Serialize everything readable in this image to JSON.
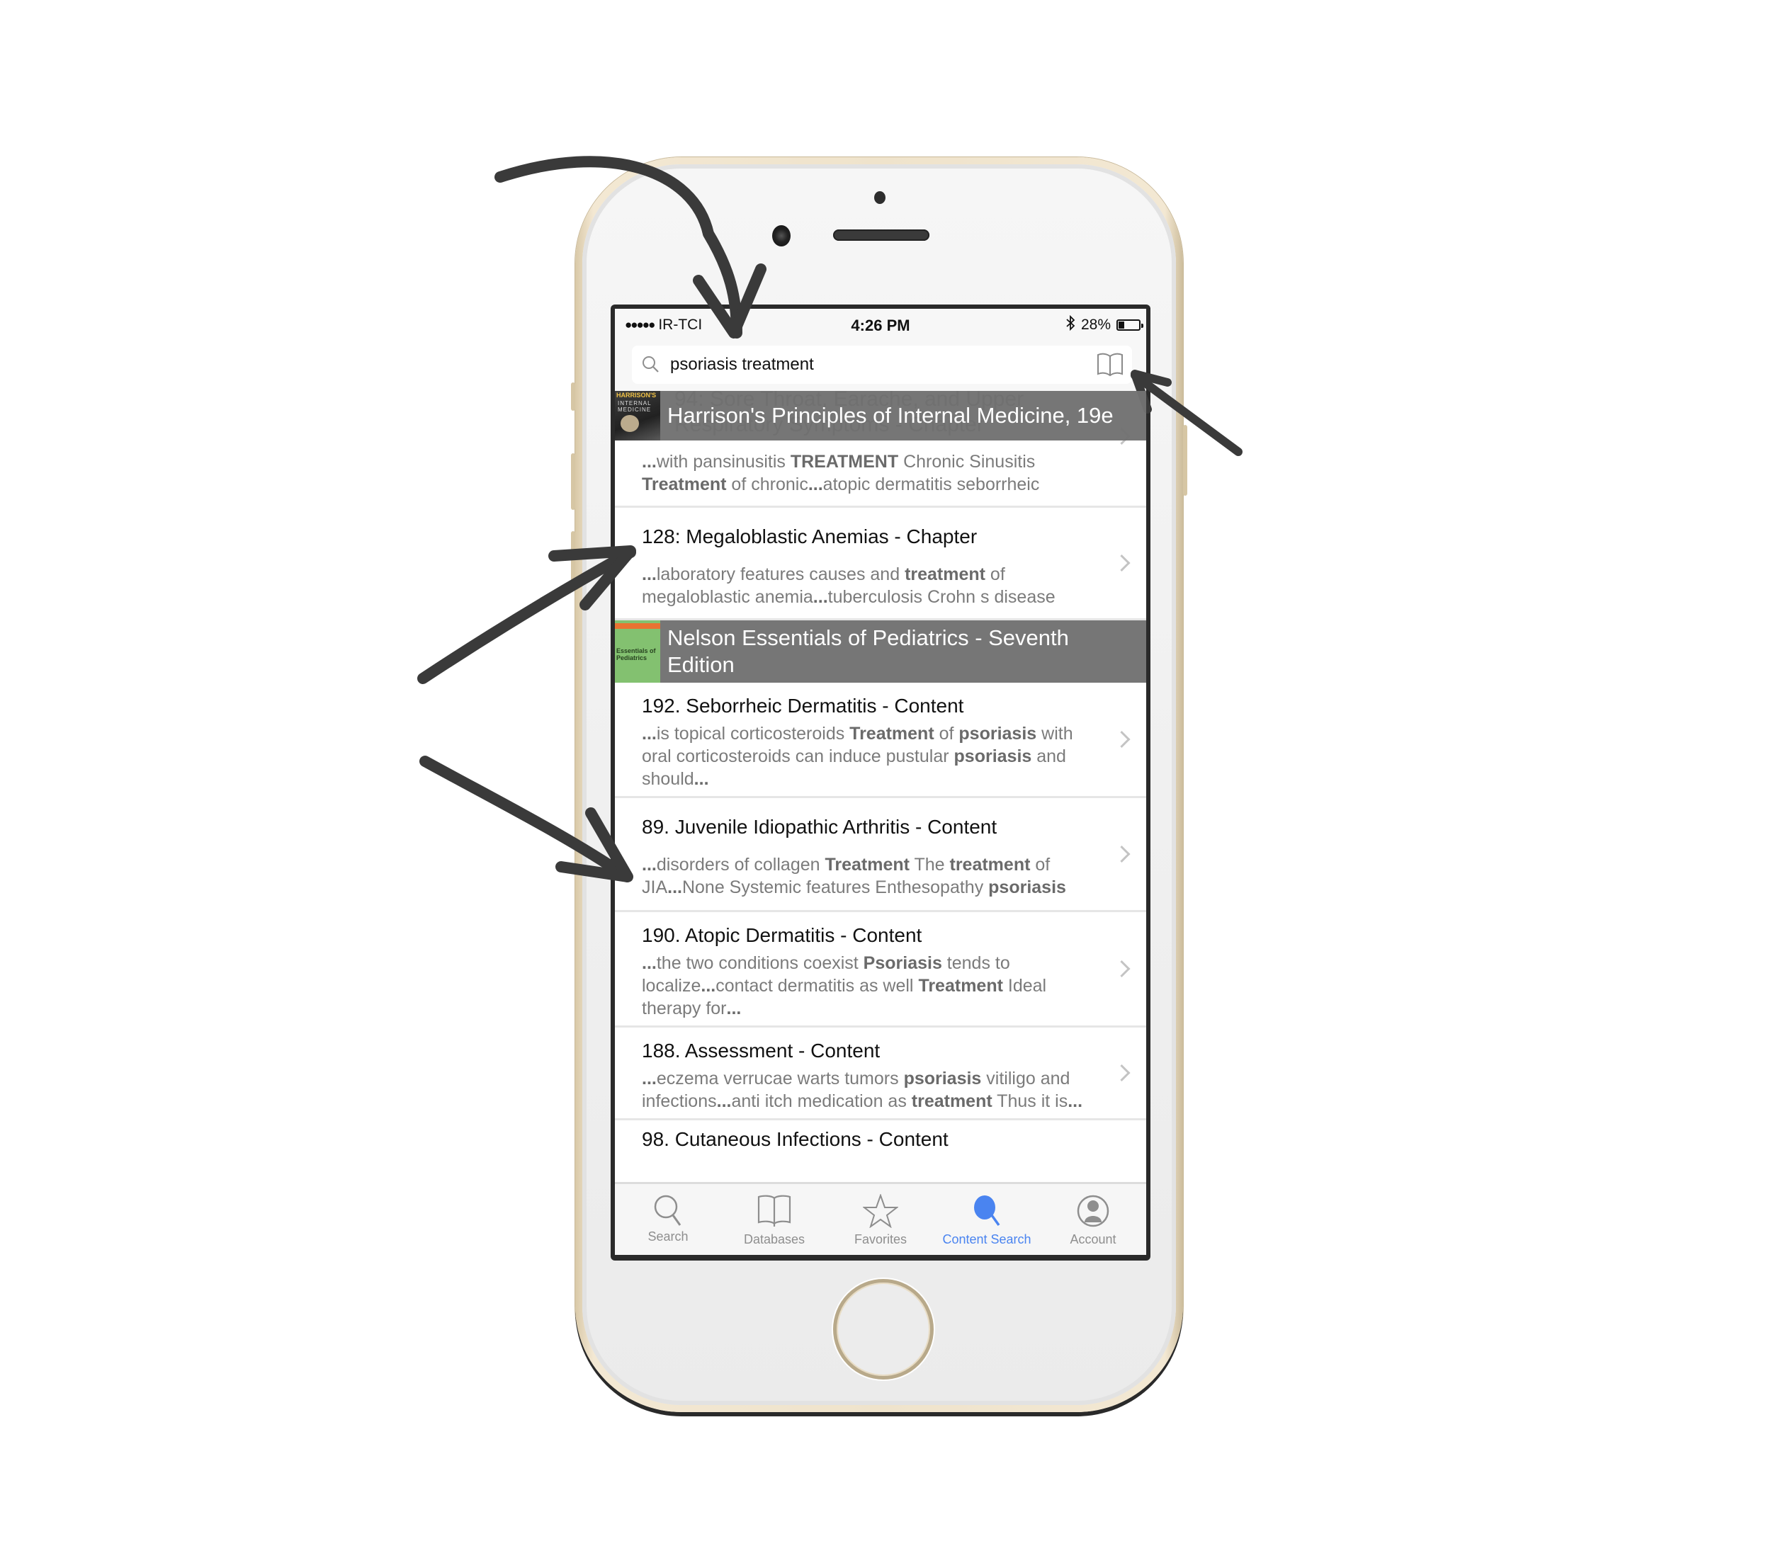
{
  "status_bar": {
    "signal_dots": "●●●●●",
    "carrier": "IR-TCI",
    "time": "4:26 PM",
    "bluetooth_icon": "bluetooth-icon",
    "battery_percent": "28%",
    "battery_level": 0.28
  },
  "search": {
    "query": "psoriasis treatment",
    "search_icon": "magnifier-icon",
    "book_icon": "open-book-icon"
  },
  "results": {
    "ghost_row_title": "94:  Sore Throat, Earache, and Upper Respiratory Symptoms - Chapter",
    "sections": [
      {
        "title": "Harrison's Principles of Internal Medicine, 19e",
        "cover_text_1": "HARRISON'S",
        "cover_text_2": "INTERNAL MEDICINE",
        "rows": [
          {
            "title": "",
            "snippet": [
              {
                "t": "...",
                "b": true
              },
              {
                "t": "with pansinusitis ",
                "b": false
              },
              {
                "t": "TREATMENT",
                "b": true
              },
              {
                "t": " Chronic Sinusitis ",
                "b": false
              },
              {
                "t": "Treatment",
                "b": true
              },
              {
                "t": " of chronic",
                "b": false
              },
              {
                "t": "...",
                "b": true
              },
              {
                "t": "atopic dermatitis seborrheic",
                "b": false
              }
            ]
          },
          {
            "title": "128:  Megaloblastic Anemias - Chapter",
            "snippet": [
              {
                "t": "...",
                "b": true
              },
              {
                "t": "laboratory features causes and ",
                "b": false
              },
              {
                "t": "treatment",
                "b": true
              },
              {
                "t": " of megaloblastic anemia",
                "b": false
              },
              {
                "t": "...",
                "b": true
              },
              {
                "t": "tuberculosis Crohn s disease",
                "b": false
              }
            ]
          }
        ]
      },
      {
        "title": "Nelson Essentials of Pediatrics - Seventh Edition",
        "cover_text_1": "Essentials of Pediatrics",
        "rows": [
          {
            "title": "192. Seborrheic Dermatitis - Content",
            "snippet": [
              {
                "t": "...",
                "b": true
              },
              {
                "t": "is topical corticosteroids ",
                "b": false
              },
              {
                "t": "Treatment",
                "b": true
              },
              {
                "t": " of ",
                "b": false
              },
              {
                "t": "psoriasis",
                "b": true
              },
              {
                "t": " with oral corticosteroids can induce pustular ",
                "b": false
              },
              {
                "t": "psoriasis",
                "b": true
              },
              {
                "t": " and should",
                "b": false
              },
              {
                "t": "...",
                "b": true
              }
            ]
          },
          {
            "title": "89. Juvenile Idiopathic Arthritis - Content",
            "snippet": [
              {
                "t": "...",
                "b": true
              },
              {
                "t": "disorders of collagen ",
                "b": false
              },
              {
                "t": "Treatment",
                "b": true
              },
              {
                "t": " The ",
                "b": false
              },
              {
                "t": "treatment",
                "b": true
              },
              {
                "t": " of JIA",
                "b": false
              },
              {
                "t": "...",
                "b": true
              },
              {
                "t": "None Systemic features Enthesopathy ",
                "b": false
              },
              {
                "t": "psoriasis",
                "b": true
              }
            ]
          },
          {
            "title": "190. Atopic Dermatitis - Content",
            "snippet": [
              {
                "t": "...",
                "b": true
              },
              {
                "t": "the two conditions coexist ",
                "b": false
              },
              {
                "t": "Psoriasis",
                "b": true
              },
              {
                "t": " tends to localize",
                "b": false
              },
              {
                "t": "...",
                "b": true
              },
              {
                "t": "contact dermatitis as well ",
                "b": false
              },
              {
                "t": "Treatment",
                "b": true
              },
              {
                "t": " Ideal therapy for",
                "b": false
              },
              {
                "t": "...",
                "b": true
              }
            ]
          },
          {
            "title": "188. Assessment - Content",
            "snippet": [
              {
                "t": "...",
                "b": true
              },
              {
                "t": "eczema verrucae warts tumors ",
                "b": false
              },
              {
                "t": "psoriasis",
                "b": true
              },
              {
                "t": " vitiligo and infections",
                "b": false
              },
              {
                "t": "...",
                "b": true
              },
              {
                "t": "anti itch medication as ",
                "b": false
              },
              {
                "t": "treatment",
                "b": true
              },
              {
                "t": " Thus it is",
                "b": false
              },
              {
                "t": "...",
                "b": true
              }
            ]
          },
          {
            "title": "98. Cutaneous Infections - Content",
            "snippet": []
          }
        ]
      }
    ]
  },
  "tab_bar": {
    "tabs": [
      {
        "label": "Search",
        "icon": "search-icon",
        "active": false
      },
      {
        "label": "Databases",
        "icon": "book-icon",
        "active": false
      },
      {
        "label": "Favorites",
        "icon": "star-icon",
        "active": false
      },
      {
        "label": "Content Search",
        "icon": "content-search-icon",
        "active": true
      },
      {
        "label": "Account",
        "icon": "account-icon",
        "active": false
      }
    ]
  },
  "colors": {
    "accent": "#4a84f0",
    "section_header_bg": "#727272",
    "snippet_text": "#7b7b7b",
    "phone_gold": "#efe3cb",
    "annotation_arrow": "#3a3a3a"
  },
  "annotations": {
    "arrow_count": 4,
    "targets": [
      "search-bar",
      "book-icon",
      "result-row-128",
      "result-row-89"
    ]
  }
}
